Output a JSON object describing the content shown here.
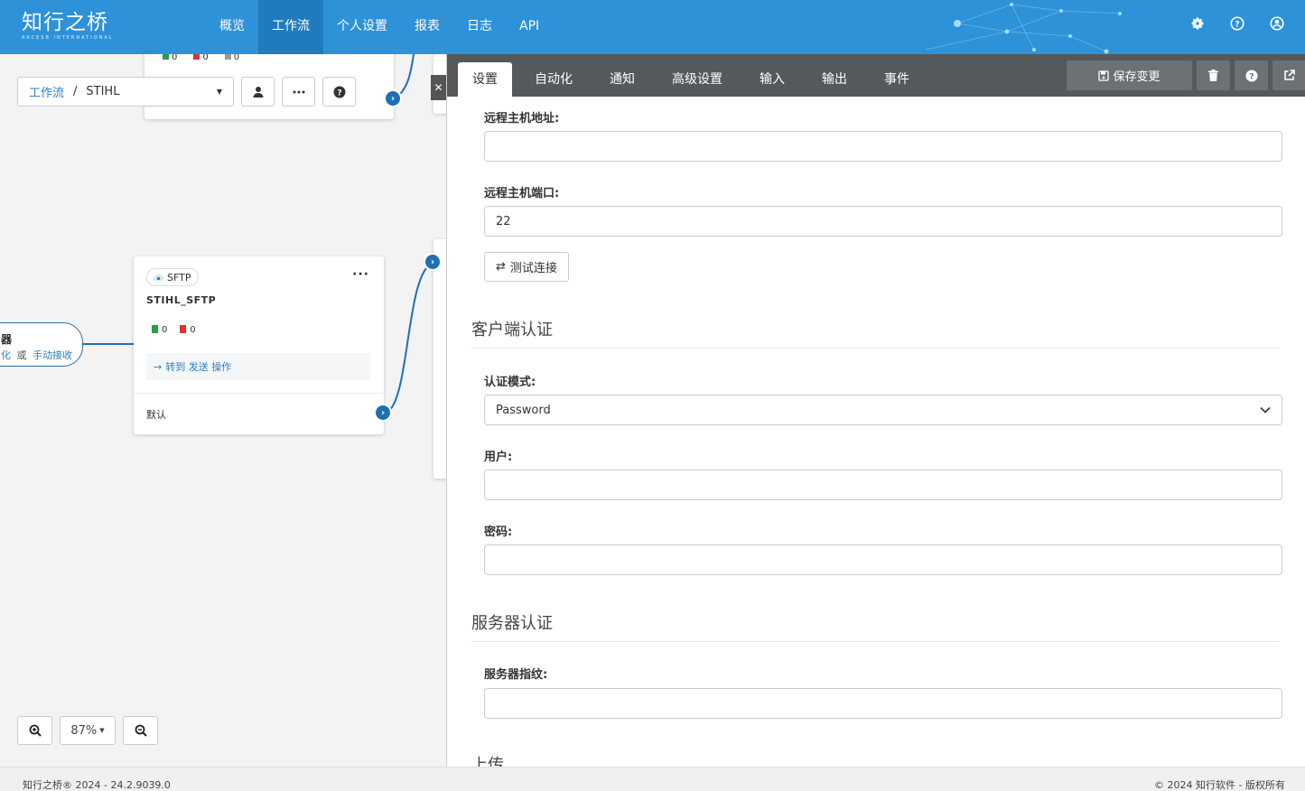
{
  "app": {
    "logo_text": "知行之桥",
    "logo_sub": "ARCESB INTERNATIONAL"
  },
  "nav": {
    "items": [
      {
        "label": "概览"
      },
      {
        "label": "工作流",
        "active": true
      },
      {
        "label": "个人设置"
      },
      {
        "label": "报表"
      },
      {
        "label": "日志"
      },
      {
        "label": "API"
      }
    ],
    "icons": [
      "gear-icon",
      "help-circle-icon",
      "user-circle-icon"
    ]
  },
  "canvas": {
    "breadcrumb": {
      "root": "工作流",
      "separator": "/",
      "current": "STIHL"
    },
    "top_node_counts": [
      "0",
      "0",
      "0"
    ],
    "sftp_node": {
      "badge": "SFTP",
      "title": "STIHL_SFTP",
      "ok_count": "0",
      "err_count": "0",
      "link_text": "转到 发送 操作",
      "footer_label": "默认"
    },
    "left_pill": {
      "title": "器",
      "subtitle_a": "化",
      "subtitle_or": "或",
      "subtitle_b": "手动接收"
    },
    "zoom_level": "87%"
  },
  "panel": {
    "tabs": [
      {
        "label": "设置",
        "active": true
      },
      {
        "label": "自动化"
      },
      {
        "label": "通知"
      },
      {
        "label": "高级设置"
      },
      {
        "label": "输入"
      },
      {
        "label": "输出"
      },
      {
        "label": "事件"
      }
    ],
    "save_label": "保存变更",
    "fields": {
      "remote_host_label": "远程主机地址:",
      "remote_host_value": "",
      "remote_port_label": "远程主机端口:",
      "remote_port_value": "22",
      "test_connection": "测试连接",
      "client_auth_section": "客户端认证",
      "auth_mode_label": "认证模式:",
      "auth_mode_value": "Password",
      "user_label": "用户:",
      "user_value": "",
      "password_label": "密码:",
      "password_value": "",
      "server_auth_section": "服务器认证",
      "fingerprint_label": "服务器指纹:",
      "fingerprint_value": "",
      "upload_section": "上传"
    }
  },
  "footer": {
    "left": "知行之桥® 2024 - 24.2.9039.0",
    "right": "© 2024 知行软件 - 版权所有"
  },
  "colors": {
    "header": "#2d92d8",
    "accent": "#1f6fb5",
    "tabbar": "#55595c"
  }
}
